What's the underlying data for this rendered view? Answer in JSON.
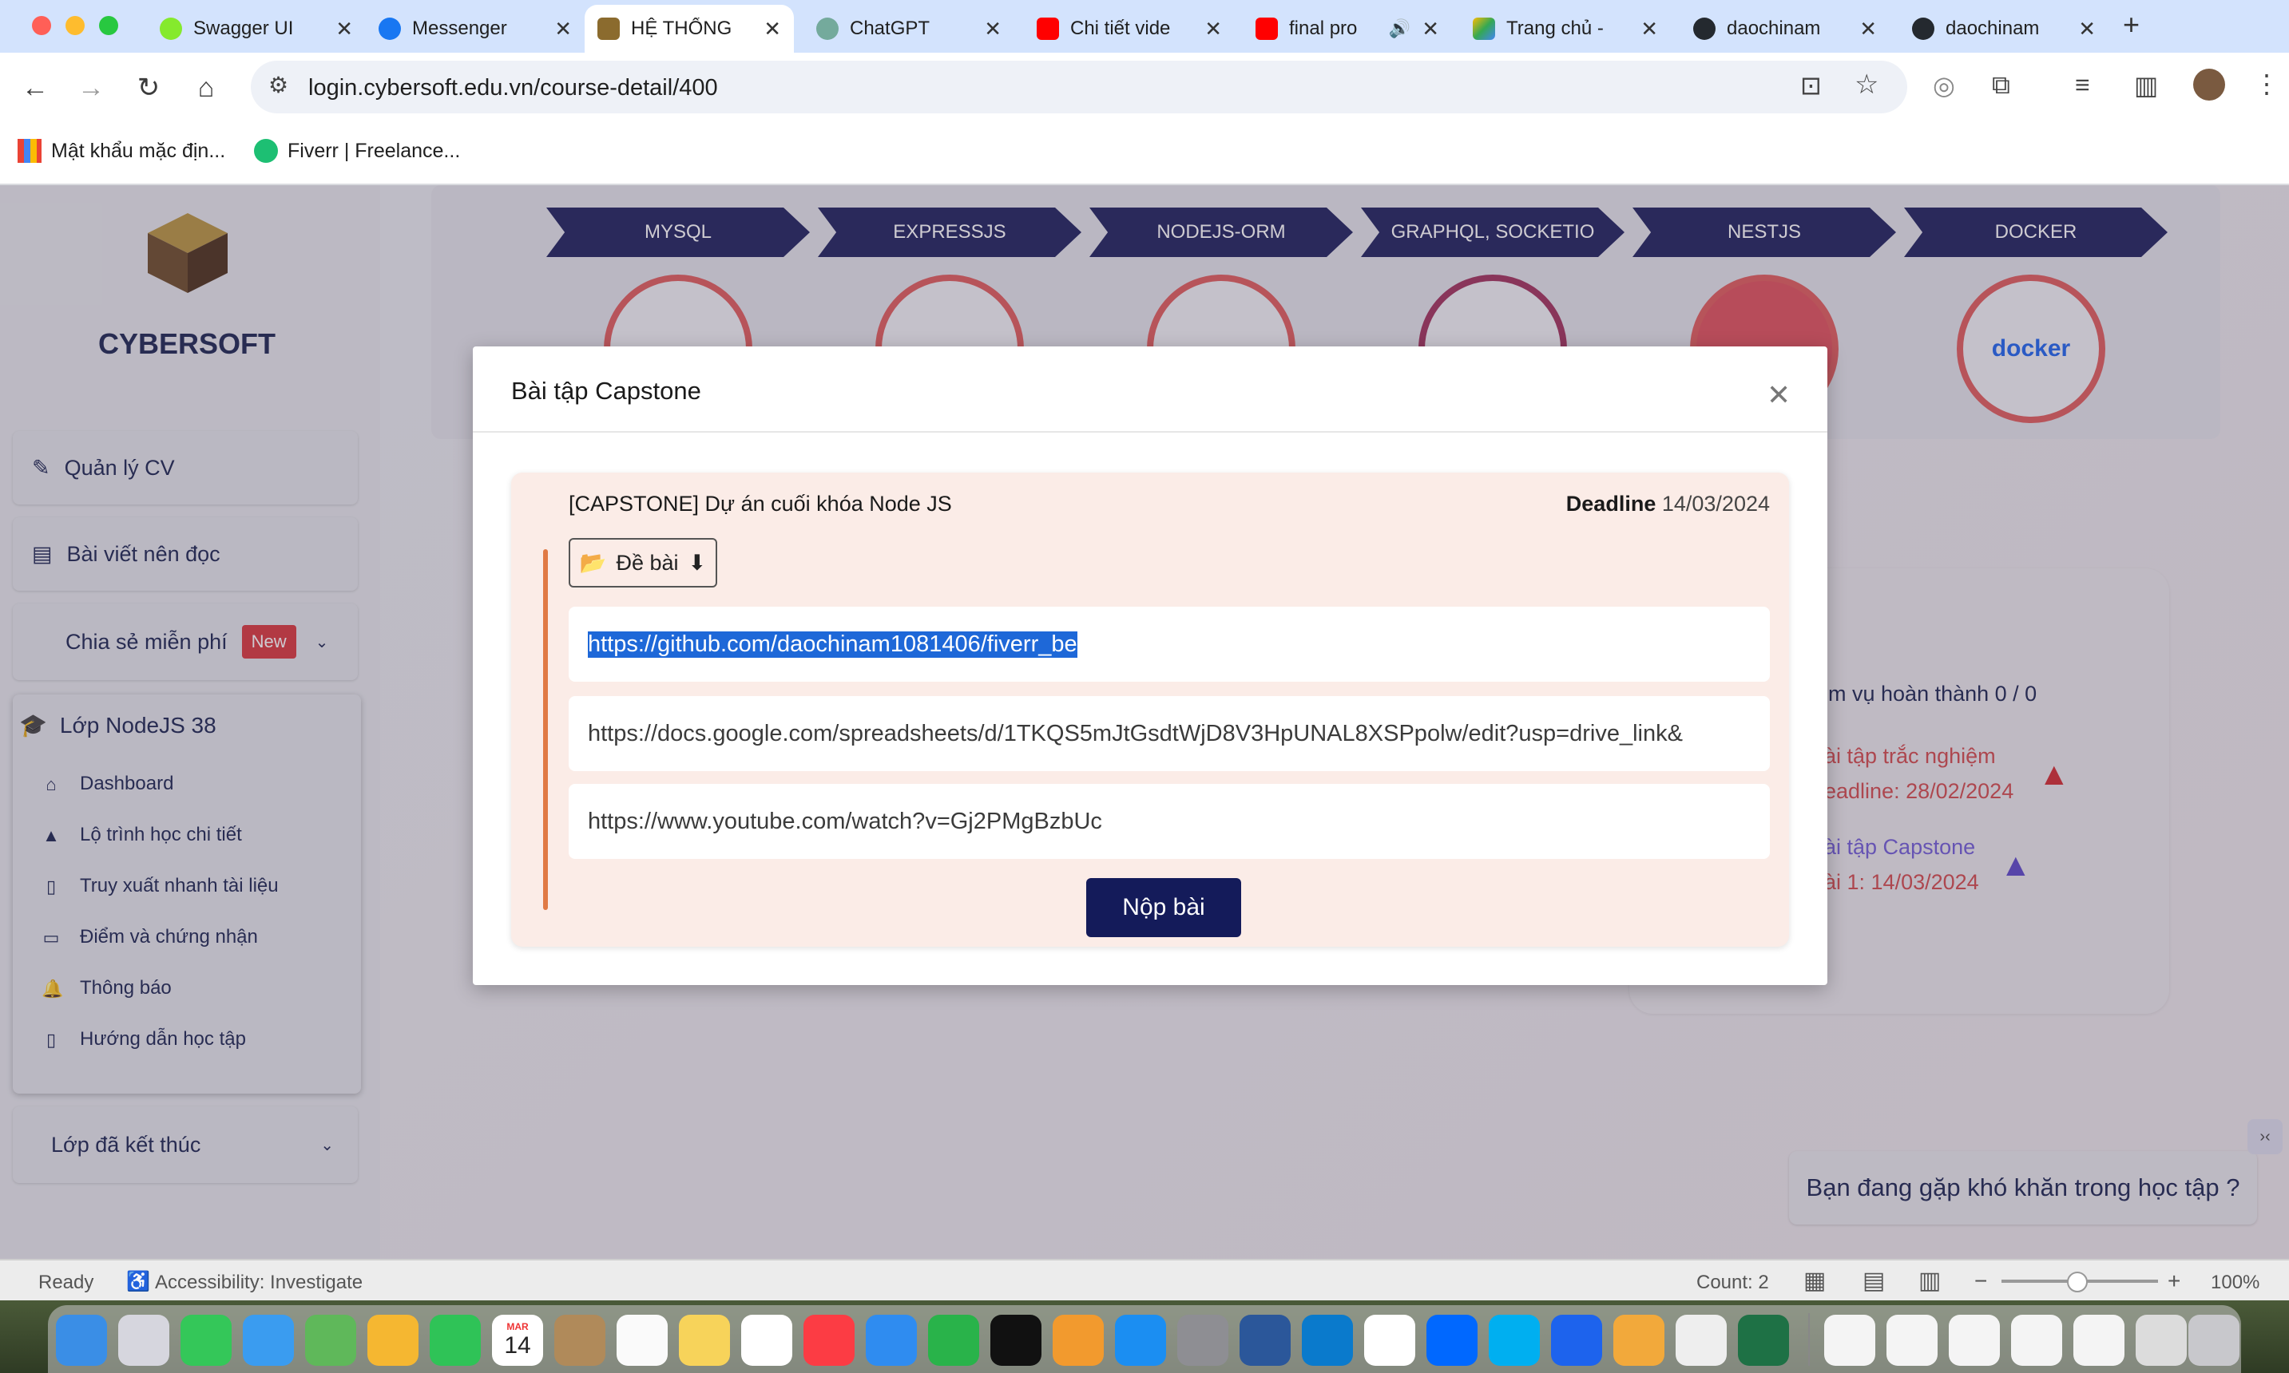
{
  "browser": {
    "tabs": [
      {
        "label": "Swagger UI",
        "favicon_color": "#85ea2d"
      },
      {
        "label": "Messenger",
        "favicon_color": "#1877f2"
      },
      {
        "label": "HỆ THỐNG",
        "favicon_color": "#8b6b2e"
      },
      {
        "label": "ChatGPT",
        "favicon_color": "#74aa9c"
      },
      {
        "label": "Chi tiết vide",
        "favicon_color": "#ff0000"
      },
      {
        "label": "final pro",
        "favicon_color": "#ff0000"
      },
      {
        "label": "Trang chủ -",
        "favicon_color": "#34a853"
      },
      {
        "label": "daochinam",
        "favicon_color": "#24292f"
      },
      {
        "label": "daochinam",
        "favicon_color": "#24292f"
      }
    ],
    "url": "login.cybersoft.edu.vn/course-detail/400",
    "bookmarks": [
      "Mật khẩu mặc địn...",
      "Fiverr | Freelance..."
    ]
  },
  "sidebar": {
    "brand": "CYBERSOFT",
    "cards": {
      "cv": "Quản lý CV",
      "articles": "Bài viết nên đọc",
      "free_share": "Chia sẻ miễn phí",
      "new_badge": "New"
    },
    "course": {
      "title": "Lớp NodeJS 38",
      "items": [
        "Dashboard",
        "Lộ trình học chi tiết",
        "Truy xuất nhanh tài liệu",
        "Điểm và chứng nhận",
        "Thông báo",
        "Hướng dẫn học tập"
      ]
    },
    "finished": "Lớp đã kết thúc"
  },
  "roadmap": {
    "steps": [
      "MYSQL",
      "EXPRESSJS",
      "NODEJS-ORM",
      "GRAPHQL, SOCKETIO",
      "NESTJS",
      "DOCKER"
    ],
    "docker_label": "docker"
  },
  "right_panel": {
    "tasks_done": "iệm vụ hoàn thành 0 / 0",
    "quiz_label": "ài tập trắc nghiệm",
    "quiz_deadline": "eadline: 28/02/2024",
    "capstone_label": "ài tập Capstone",
    "capstone_deadline": "ài 1: 14/03/2024"
  },
  "help_button": "Bạn đang gặp khó khăn trong học tập ?",
  "modal": {
    "title": "Bài tập Capstone",
    "task_name": "[CAPSTONE] Dự án cuối khóa Node JS",
    "deadline_label": "Deadline",
    "deadline_value": "14/03/2024",
    "assignment_button": "Đề bài",
    "links": [
      "https://github.com/daochinam1081406/fiverr_be",
      "https://docs.google.com/spreadsheets/d/1TKQS5mJtGsdtWjD8V3HpUNAL8XSPpolw/edit?usp=drive_link&",
      "https://www.youtube.com/watch?v=Gj2PMgBzbUc"
    ],
    "submit": "Nộp bài"
  },
  "statusbar": {
    "ready": "Ready",
    "accessibility": "Accessibility: Investigate",
    "count": "Count: 2",
    "zoom": "100%"
  },
  "dock": {
    "calendar_month": "MAR",
    "calendar_day": "14",
    "apps": [
      "Finder",
      "Launchpad",
      "Messages",
      "Mail",
      "Maps",
      "Photos",
      "FaceTime",
      "Calendar",
      "Contacts",
      "Reminders",
      "Notes",
      "Freeform",
      "Music",
      "Keynote",
      "Numbers",
      "TV",
      "Pages",
      "App Store",
      "System Settings",
      "Word",
      "VS Code",
      "Chrome",
      "Zalo",
      "Skype",
      "Docker",
      "TablePlus",
      "TextEdit",
      "Excel",
      "Trash"
    ]
  }
}
